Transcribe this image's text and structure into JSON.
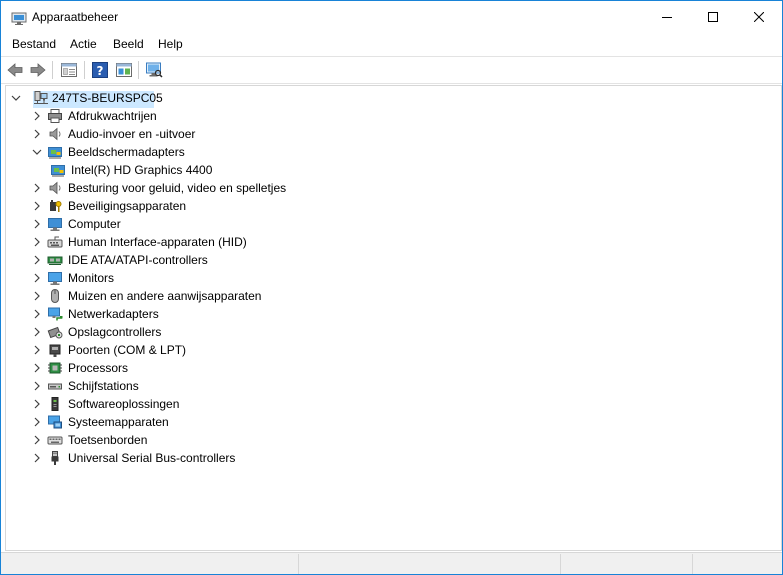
{
  "window": {
    "title": "Apparaatbeheer"
  },
  "menu": [
    "Bestand",
    "Actie",
    "Beeld",
    "Help"
  ],
  "toolbar": [
    "back-icon",
    "forward-icon",
    "properties-icon",
    "help-icon",
    "update-driver-icon",
    "scan-hardware-icon"
  ],
  "tree": {
    "root": "247TS-BEURSPC05",
    "categories": [
      {
        "label": "Afdrukwachtrijen",
        "icon": "printer-icon",
        "expanded": false
      },
      {
        "label": "Audio-invoer en -uitvoer",
        "icon": "speaker-icon",
        "expanded": false
      },
      {
        "label": "Beeldschermadapters",
        "icon": "display-adapter-icon",
        "expanded": true,
        "children": [
          {
            "label": "Intel(R) HD Graphics 4400",
            "icon": "display-adapter-icon"
          }
        ]
      },
      {
        "label": "Besturing voor geluid, video en spelletjes",
        "icon": "speaker-icon",
        "expanded": false
      },
      {
        "label": "Beveiligingsapparaten",
        "icon": "security-device-icon",
        "expanded": false
      },
      {
        "label": "Computer",
        "icon": "computer-icon",
        "expanded": false
      },
      {
        "label": "Human Interface-apparaten (HID)",
        "icon": "hid-icon",
        "expanded": false
      },
      {
        "label": "IDE ATA/ATAPI-controllers",
        "icon": "ide-controller-icon",
        "expanded": false
      },
      {
        "label": "Monitors",
        "icon": "monitor-icon",
        "expanded": false
      },
      {
        "label": "Muizen en andere aanwijsapparaten",
        "icon": "mouse-icon",
        "expanded": false
      },
      {
        "label": "Netwerkadapters",
        "icon": "network-adapter-icon",
        "expanded": false
      },
      {
        "label": "Opslagcontrollers",
        "icon": "storage-controller-icon",
        "expanded": false
      },
      {
        "label": "Poorten (COM & LPT)",
        "icon": "port-icon",
        "expanded": false
      },
      {
        "label": "Processors",
        "icon": "processor-icon",
        "expanded": false
      },
      {
        "label": "Schijfstations",
        "icon": "disk-drive-icon",
        "expanded": false
      },
      {
        "label": "Softwareoplossingen",
        "icon": "software-component-icon",
        "expanded": false
      },
      {
        "label": "Systeemapparaten",
        "icon": "system-device-icon",
        "expanded": false
      },
      {
        "label": "Toetsenborden",
        "icon": "keyboard-icon",
        "expanded": false
      },
      {
        "label": "Universal Serial Bus-controllers",
        "icon": "usb-icon",
        "expanded": false
      }
    ]
  }
}
